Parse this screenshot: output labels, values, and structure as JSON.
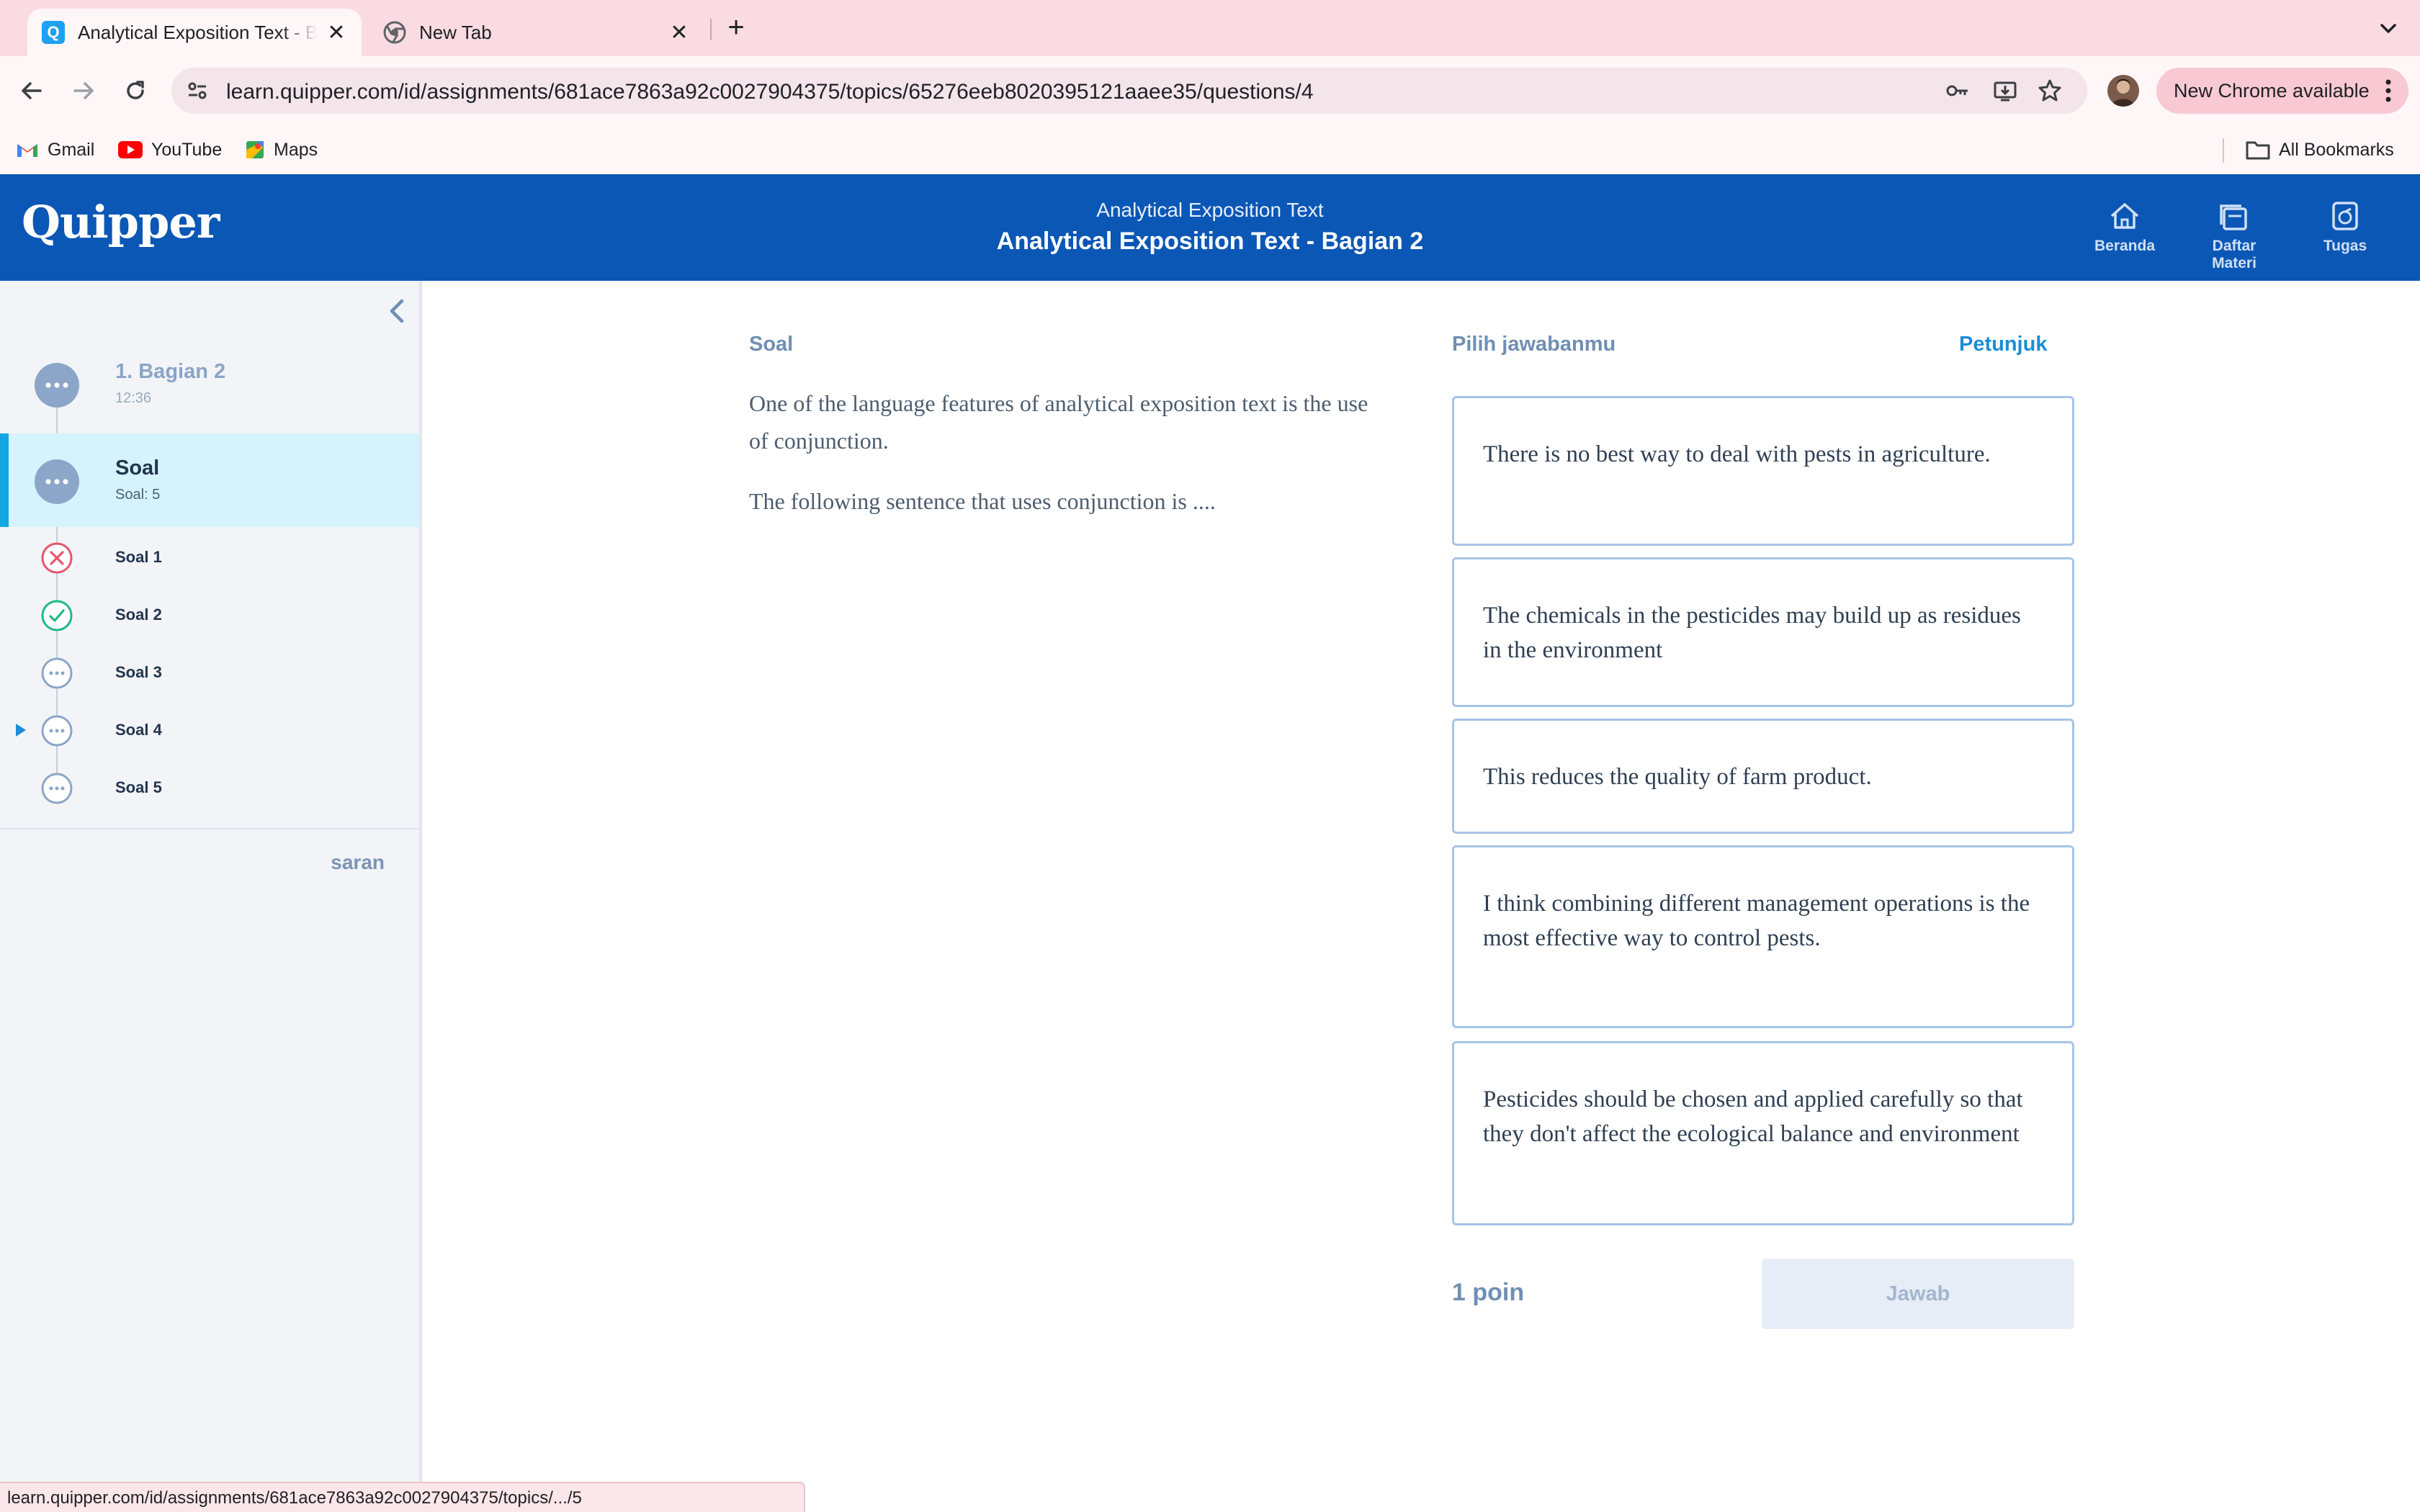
{
  "browser": {
    "tabs": [
      {
        "title": "Analytical Exposition Text - Bagian 2",
        "close": "✕"
      },
      {
        "title": "New Tab",
        "close": "✕"
      }
    ],
    "new_tab": "+",
    "url": "learn.quipper.com/id/assignments/681ace7863a92c0027904375/topics/65276eeb8020395121aaee35/questions/4",
    "update_label": "New Chrome available",
    "bookmarks": [
      {
        "label": "Gmail",
        "icon": "gmail-icon"
      },
      {
        "label": "YouTube",
        "icon": "youtube-icon"
      },
      {
        "label": "Maps",
        "icon": "maps-icon"
      }
    ],
    "all_bookmarks": "All Bookmarks",
    "status_url": "learn.quipper.com/id/assignments/681ace7863a92c0027904375/topics/.../5"
  },
  "header": {
    "logo": "Quipper",
    "course": "Analytical Exposition Text",
    "lesson": "Analytical Exposition Text - Bagian 2",
    "nav": [
      {
        "label": "Beranda",
        "icon": "home-icon"
      },
      {
        "label": "Daftar Materi",
        "icon": "list-icon"
      },
      {
        "label": "Tugas",
        "icon": "assignment-icon"
      }
    ],
    "brand_color": "#0b57b5"
  },
  "sidebar": {
    "sections": [
      {
        "title": "1. Bagian 2",
        "sub": "12:36"
      },
      {
        "title": "Soal",
        "sub": "Soal: 5"
      }
    ],
    "questions": [
      {
        "label": "Soal 1",
        "status": "wrong"
      },
      {
        "label": "Soal 2",
        "status": "correct"
      },
      {
        "label": "Soal 3",
        "status": "pending"
      },
      {
        "label": "Soal 4",
        "status": "current"
      },
      {
        "label": "Soal 5",
        "status": "pending"
      }
    ],
    "feedback": "saran"
  },
  "main": {
    "soal_label": "Soal",
    "question_p1": "One of the language features of analytical exposition text is the use of conjunction.",
    "question_p2": "The following sentence that uses conjunction is ....",
    "choose_label": "Pilih jawabanmu",
    "hint_label": "Petunjuk",
    "choices": [
      "There is no best way to deal with pests in agriculture.",
      "The chemicals in the pesticides may build up as residues in the environment",
      "This reduces the quality of farm product.",
      "I think combining different management operations is the most effective way to control pests.",
      "Pesticides should be chosen and applied carefully so that they don't affect the ecological balance and environment"
    ],
    "points": "1 poin",
    "answer_button": "Jawab"
  }
}
